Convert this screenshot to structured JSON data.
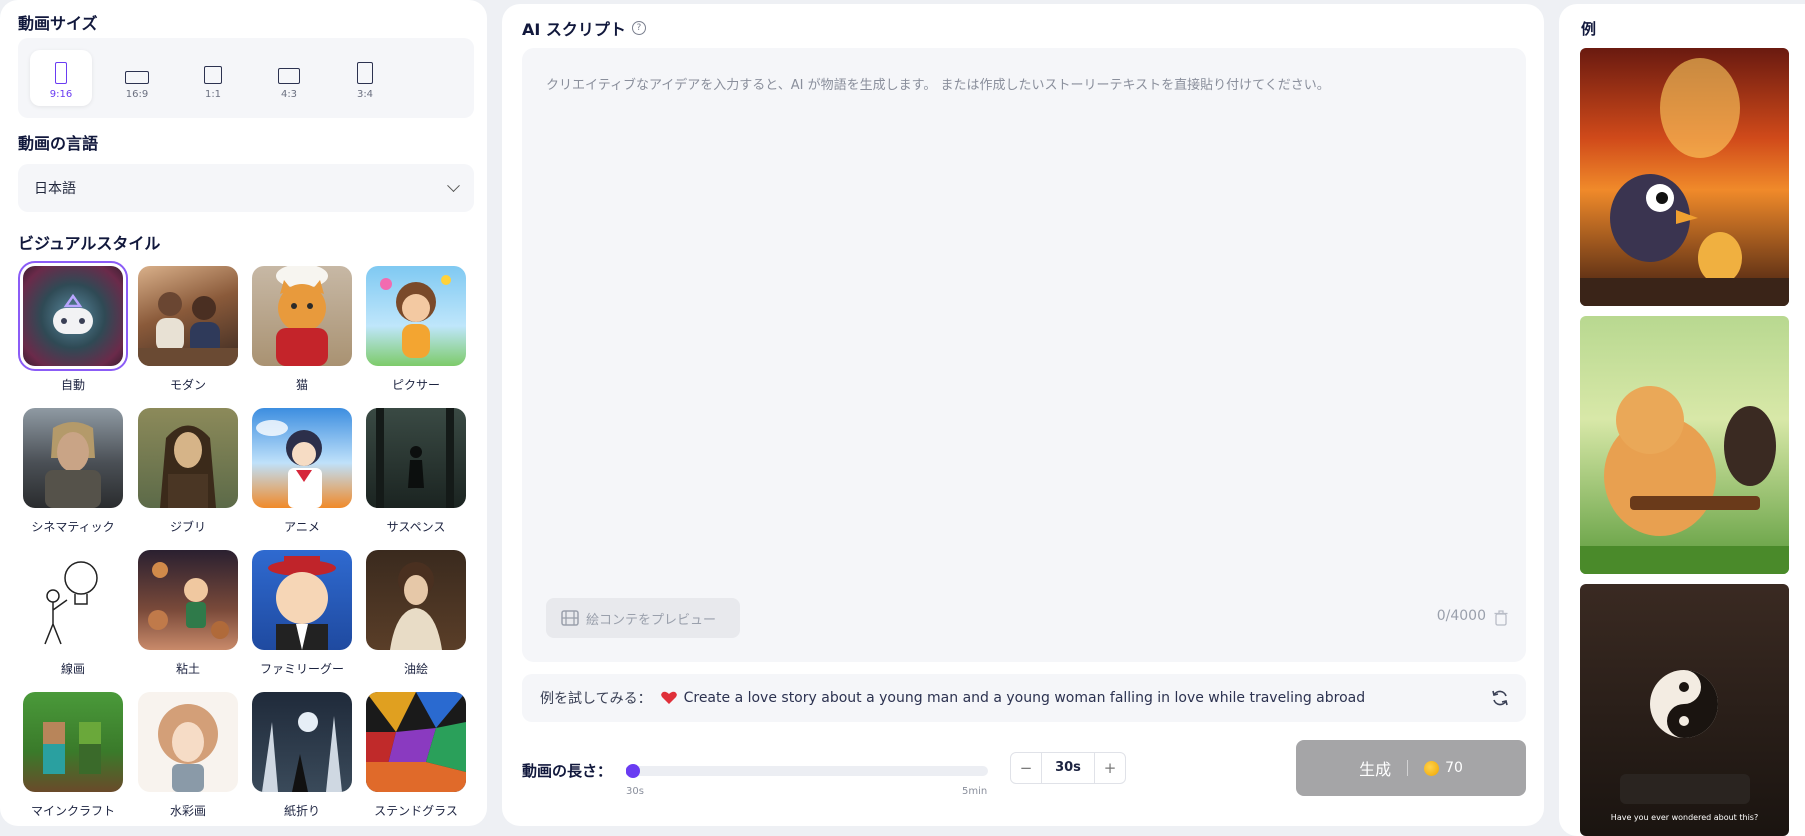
{
  "left": {
    "size_title": "動画サイズ",
    "aspects": [
      {
        "label": "9:16"
      },
      {
        "label": "16:9"
      },
      {
        "label": "1:1"
      },
      {
        "label": "4:3"
      },
      {
        "label": "3:4"
      }
    ],
    "selected_aspect": "9:16",
    "language_title": "動画の言語",
    "language_value": "日本語",
    "style_title": "ビジュアルスタイル",
    "styles": [
      {
        "label": "自動"
      },
      {
        "label": "モダン"
      },
      {
        "label": "猫"
      },
      {
        "label": "ピクサー"
      },
      {
        "label": "シネマティック"
      },
      {
        "label": "ジブリ"
      },
      {
        "label": "アニメ"
      },
      {
        "label": "サスペンス"
      },
      {
        "label": "線画"
      },
      {
        "label": "粘土"
      },
      {
        "label": "ファミリーグー"
      },
      {
        "label": "油絵"
      },
      {
        "label": "マインクラフト"
      },
      {
        "label": "水彩画"
      },
      {
        "label": "紙折り"
      },
      {
        "label": "ステンドグラス"
      }
    ],
    "selected_style": "自動"
  },
  "script": {
    "title": "AI スクリプト",
    "help": "?",
    "placeholder": "クリエイティブなアイデアを入力すると、AI が物語を生成します。 または作成したいストーリーテキストを直接貼り付けてください。",
    "storyboard_label": "絵コンテをプレビュー",
    "counter": "0/4000"
  },
  "example": {
    "prefix": "例を試してみる：",
    "text": "Create a love story about a young man and a young woman falling in love while traveling abroad"
  },
  "duration": {
    "label": "動画の長さ：",
    "min_label": "30s",
    "max_label": "5min",
    "value": "30s",
    "progress": 0.0,
    "minus": "−",
    "plus": "+"
  },
  "generate": {
    "label": "生成",
    "cost": "70"
  },
  "examples_panel": {
    "title": "例",
    "caption3": "Have you ever wondered about this?"
  },
  "colors": {
    "accent": "#6a3cf2",
    "button_disabled": "#a5a5a7"
  }
}
